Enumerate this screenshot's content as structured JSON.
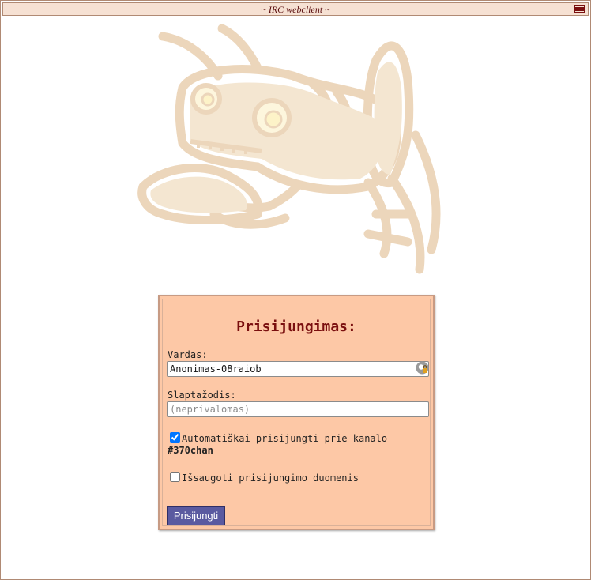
{
  "window": {
    "title": "~ IRC webclient ~"
  },
  "login": {
    "heading": "Prisijungimas:",
    "nick_label": "Vardas:",
    "nick_value": "Anonimas-08raiob",
    "password_label": "Slaptažodis:",
    "password_placeholder": "(neprivalomas)",
    "autojoin_label": "Automatiškai prisijungti prie kanalo",
    "autojoin_checked": true,
    "autojoin_channel": "#370chan",
    "remember_label": "Išsaugoti prisijungimo duomenis",
    "remember_checked": false,
    "submit_label": "Prisijungti"
  },
  "icons": {
    "menu": "hamburger-menu-icon",
    "key": "key-lock-icon"
  },
  "colors": {
    "panel_bg": "#fdc8a6",
    "heading": "#7a0f0f",
    "button_bg": "#5a5aa0",
    "titlebar_bg": "#f6e1d3",
    "mascot": "#ecd6bb"
  }
}
